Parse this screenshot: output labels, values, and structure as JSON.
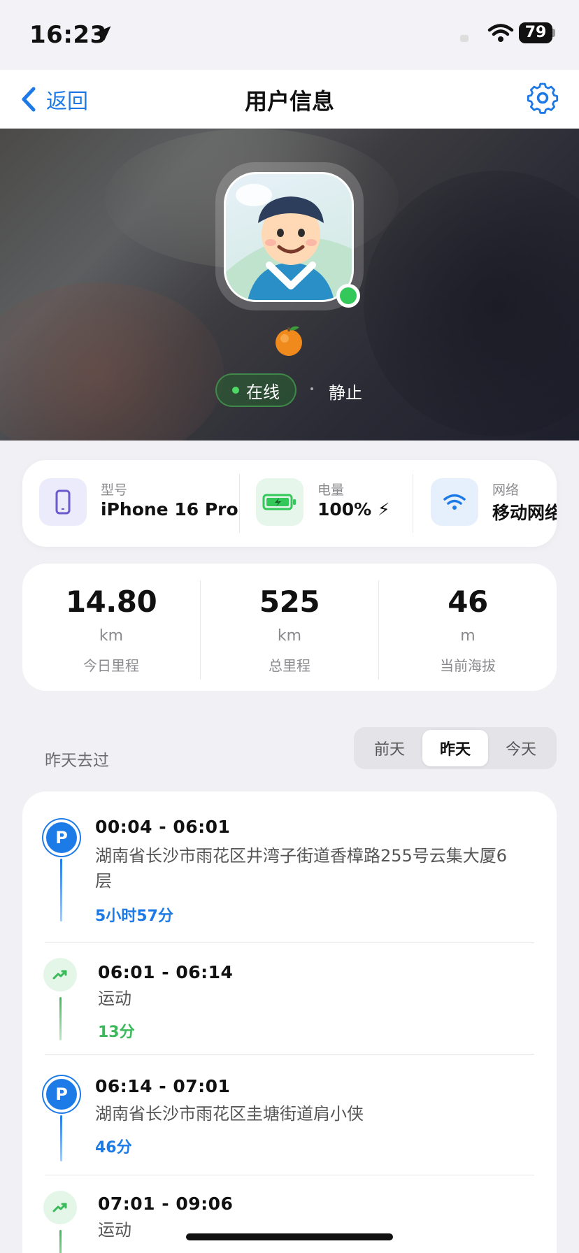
{
  "status_bar": {
    "time": "16:23",
    "battery": "79"
  },
  "nav": {
    "back_label": "返回",
    "title": "用户信息"
  },
  "profile": {
    "status_label": "在线",
    "motion_label": "静止"
  },
  "device": [
    {
      "label": "型号",
      "value": "iPhone 16 Pro",
      "icon": "phone-icon"
    },
    {
      "label": "电量",
      "value": "100% ⚡",
      "icon": "battery-charging-icon"
    },
    {
      "label": "网络",
      "value": "移动网络",
      "icon": "wifi-icon"
    }
  ],
  "stats": [
    {
      "value": "14.80",
      "unit": "km",
      "label": "今日里程"
    },
    {
      "value": "525",
      "unit": "km",
      "label": "总里程"
    },
    {
      "value": "46",
      "unit": "m",
      "label": "当前海拔"
    }
  ],
  "history": {
    "title": "昨天去过",
    "tabs": [
      "前天",
      "昨天",
      "今天"
    ],
    "active_tab": "昨天",
    "items": [
      {
        "type": "parking",
        "time": "00:04 - 06:01",
        "address_line1": "湖南省长沙市雨花区井湾子街道香樟路255号云集大厦6",
        "address_line2": "层",
        "duration": "5小时57分"
      },
      {
        "type": "moving",
        "time": "06:01 - 06:14",
        "address_line1": "运动",
        "duration": "13分"
      },
      {
        "type": "parking",
        "time": "06:14 - 07:01",
        "address_line1": "湖南省长沙市雨花区圭塘街道肩小侠",
        "duration": "46分"
      },
      {
        "type": "moving",
        "time": "07:01 - 09:06",
        "address_line1": "运动"
      }
    ]
  },
  "colors": {
    "accent_blue": "#1d7be8",
    "online_green": "#34c759",
    "moving_green": "#3cb95a"
  }
}
